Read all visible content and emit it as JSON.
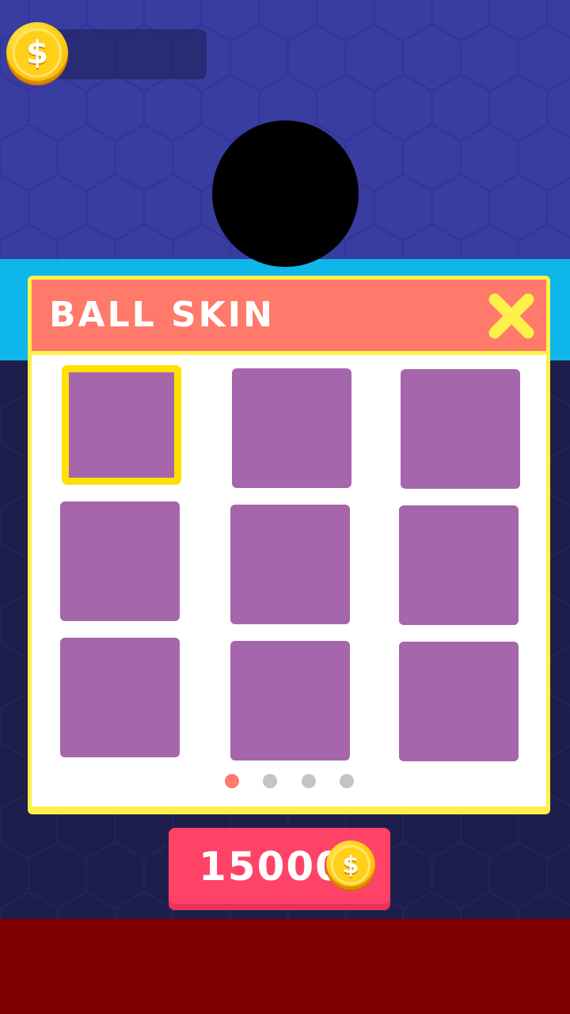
{
  "hud": {
    "coin_count": "",
    "coin_symbol": "$"
  },
  "popup": {
    "title": "BALL SKIN",
    "skins": [
      {
        "selected": true
      },
      {
        "selected": false
      },
      {
        "selected": false
      },
      {
        "selected": false
      },
      {
        "selected": false
      },
      {
        "selected": false
      },
      {
        "selected": false
      },
      {
        "selected": false
      },
      {
        "selected": false
      }
    ],
    "page_count": 4,
    "current_page": 1
  },
  "purchase": {
    "price": "15000",
    "coin_symbol": "$"
  },
  "colors": {
    "sky": "#383d9f",
    "band": "#0fb6ea",
    "navy": "#1e1e4c",
    "floor": "#800000",
    "header": "#ff7a6b",
    "panel_border": "#fff04a",
    "tile": "#a666ab",
    "selected_border": "#ffe000",
    "price_button": "#ff4366"
  }
}
